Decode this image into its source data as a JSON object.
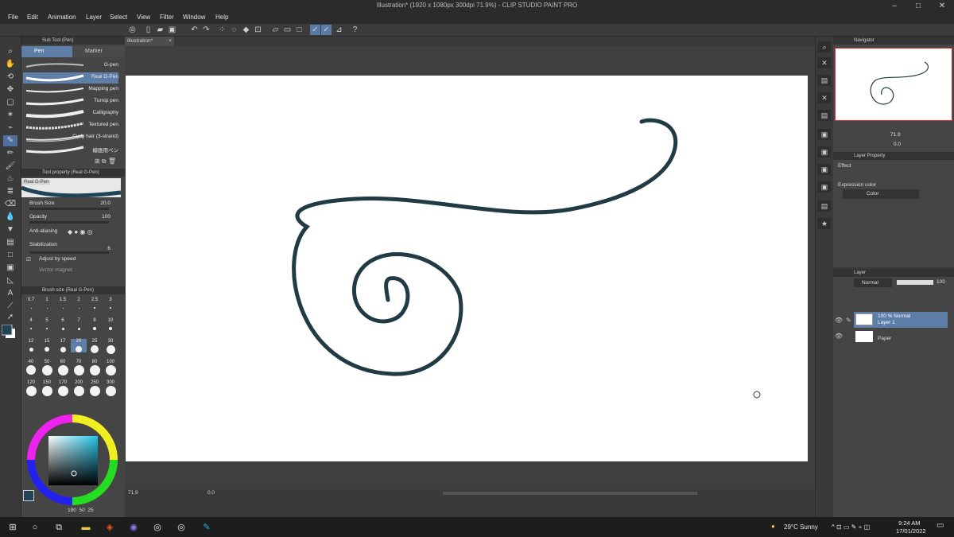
{
  "window": {
    "title": "Illustration* (1920 x 1080px 300dpi 71.9%)  - CLIP STUDIO PAINT PRO",
    "controls": [
      "–",
      "□",
      "✕"
    ]
  },
  "menu": [
    "File",
    "Edit",
    "Animation",
    "Layer",
    "Select",
    "View",
    "Filter",
    "Window",
    "Help"
  ],
  "subtool_panel": {
    "header": "Sub Tool (Pen)",
    "tabs": [
      "Pen",
      "Marker"
    ],
    "brushes": [
      "G-pen",
      "Real G-Pen",
      "Mapping pen",
      "Turnip pen",
      "Calligraphy",
      "Textured pen",
      "Curly hair (3-strand)",
      "線画用ペン"
    ],
    "selected_index": 1
  },
  "tool_property": {
    "header": "Tool property (Real G-Pen)",
    "brush_name": "Real G-Pen",
    "brush_size_label": "Brush Size",
    "brush_size_value": "20.0",
    "opacity_label": "Opacity",
    "opacity_value": "100",
    "antialiasing_label": "Anti-aliasing",
    "stabilization_label": "Stabilization",
    "stabilization_value": "6",
    "adjust_speed_label": "Adjust by speed",
    "vector_magnet_label": "Vector magnet"
  },
  "brush_size_panel": {
    "header": "Brush size (Real G-Pen)",
    "sizes": [
      "0.7",
      "1",
      "1.5",
      "2",
      "2.5",
      "3",
      "4",
      "5",
      "6",
      "7",
      "8",
      "10",
      "12",
      "15",
      "17",
      "20",
      "25",
      "30",
      "40",
      "50",
      "60",
      "70",
      "80",
      "100",
      "120",
      "150",
      "170",
      "200",
      "250",
      "300"
    ],
    "selected": "20"
  },
  "color_panel": {
    "values": [
      "190",
      "50",
      "25"
    ]
  },
  "document": {
    "tab_label": "Illustration*",
    "zoom": "71.9",
    "angle": "0.0"
  },
  "navigator": {
    "header": "Navigator",
    "zoom": "71.9",
    "angle": "0.0"
  },
  "layer_property": {
    "header": "Layer Property",
    "effect_label": "Effect",
    "expression_label": "Expression color",
    "expression_value": "Color"
  },
  "layer_panel": {
    "header": "Layer",
    "blend_mode": "Normal",
    "opacity": "100",
    "layers": [
      {
        "line1": "100 % Normal",
        "line2": "Layer 1"
      },
      {
        "line1": "",
        "line2": "Paper"
      }
    ]
  },
  "taskbar": {
    "weather": "29°C  Sunny",
    "time": "9:24 AM",
    "date": "17/01/2022"
  },
  "colors": {
    "stroke": "#223a44",
    "accent": "#5e7ea8",
    "main_color": "#1f4455"
  }
}
